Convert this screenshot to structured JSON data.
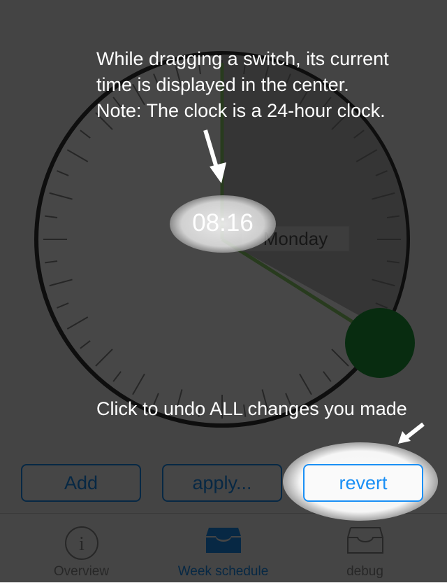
{
  "dial": {
    "day_label": "Monday",
    "current_time": "08:16",
    "clock_format": "24-hour",
    "colors": {
      "ring": "#333333",
      "active_sector": "#bdbdbd",
      "switch_line": "#8fd36b",
      "handle": "#1e9d3c"
    }
  },
  "tutorial": {
    "time_hint_lines": [
      "While dragging a switch, its current",
      "time is displayed in the center.",
      "Note: The clock is a 24-hour clock."
    ],
    "revert_hint": "Click to undo ALL changes you made"
  },
  "buttons": {
    "add_label": "Add",
    "apply_label": "apply...",
    "revert_label": "revert"
  },
  "tabbar": {
    "tabs": [
      {
        "label": "Overview",
        "icon": "info-icon",
        "active": false
      },
      {
        "label": "Week schedule",
        "icon": "inbox-icon",
        "active": true
      },
      {
        "label": "debug",
        "icon": "inbox-icon",
        "active": false
      }
    ]
  },
  "colors": {
    "accent": "#1a8ff5",
    "overlay": "#000000",
    "tab_inactive": "#8e8e8e"
  }
}
